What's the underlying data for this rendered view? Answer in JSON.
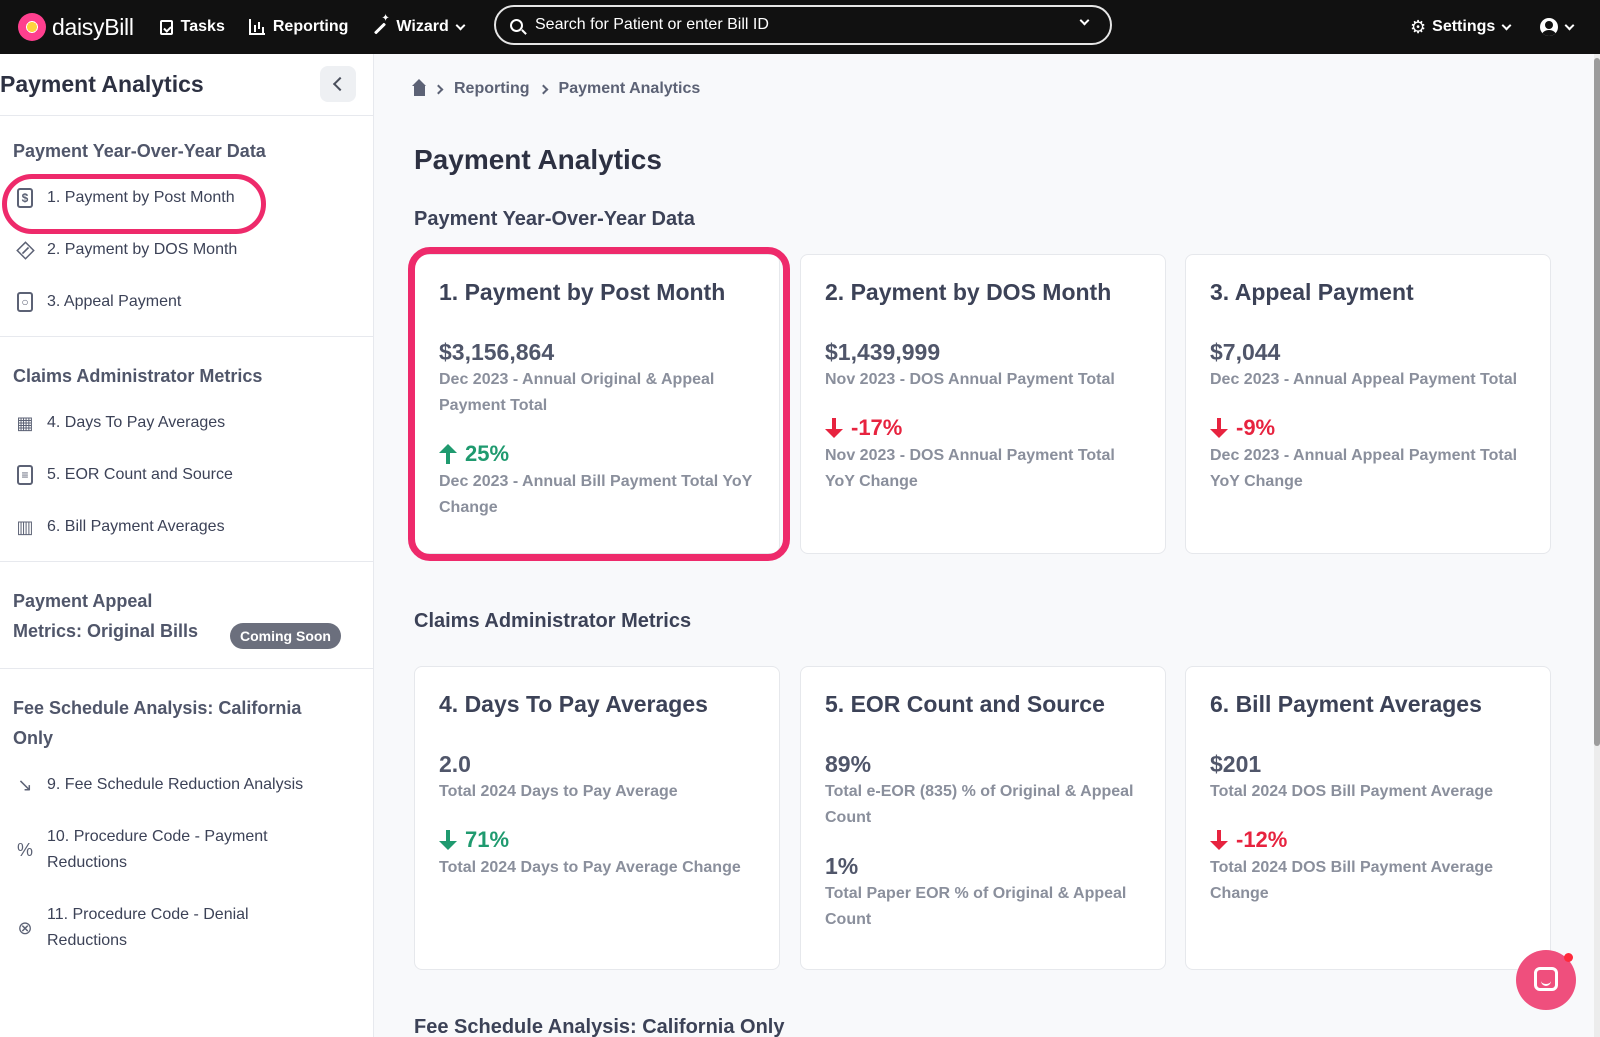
{
  "app": {
    "brand": "daisyBill"
  },
  "nav": {
    "tasks": "Tasks",
    "reporting": "Reporting",
    "wizard": "Wizard",
    "settings": "Settings"
  },
  "search": {
    "placeholder": "Search for Patient or enter Bill ID"
  },
  "sidebar": {
    "title": "Payment Analytics",
    "sections": [
      {
        "title": "Payment Year-Over-Year Data",
        "items": [
          {
            "label": "1. Payment by Post Month",
            "icon": "dollar-doc-icon"
          },
          {
            "label": "2. Payment by DOS Month",
            "icon": "bandage-icon"
          },
          {
            "label": "3. Appeal Payment",
            "icon": "appeal-doc-icon"
          }
        ]
      },
      {
        "title": "Claims Administrator Metrics",
        "items": [
          {
            "label": "4. Days To Pay Averages",
            "icon": "calendar-icon"
          },
          {
            "label": "5. EOR Count and Source",
            "icon": "document-icon"
          },
          {
            "label": "6. Bill Payment Averages",
            "icon": "bar-chart-icon"
          }
        ]
      },
      {
        "title_line1": "Payment Appeal",
        "title_line2": "Metrics: Original Bills",
        "badge": "Coming Soon"
      },
      {
        "title_line1": "Fee Schedule Analysis: California",
        "title_line2": "Only",
        "items": [
          {
            "label": "9. Fee Schedule Reduction Analysis",
            "icon": "trend-down-icon"
          },
          {
            "label_line1": "10. Procedure Code - Payment",
            "label_line2": "Reductions",
            "icon": "percent-icon"
          },
          {
            "label_line1": "11. Procedure Code - Denial",
            "label_line2": "Reductions",
            "icon": "x-circle-icon"
          }
        ]
      }
    ]
  },
  "breadcrumb": [
    "Reporting",
    "Payment Analytics"
  ],
  "main": {
    "title": "Payment Analytics",
    "section1": "Payment Year-Over-Year Data",
    "section2": "Claims Administrator Metrics",
    "section3": "Fee Schedule Analysis: California Only",
    "cards": [
      {
        "title": "1. Payment by Post Month",
        "value": "$3,156,864",
        "value_desc": "Dec 2023 - Annual Original & Appeal Payment Total",
        "change": "25%",
        "direction": "up",
        "change_desc": "Dec 2023 - Annual Bill Payment Total YoY Change"
      },
      {
        "title": "2. Payment by DOS Month",
        "value": "$1,439,999",
        "value_desc": "Nov 2023 - DOS Annual Payment Total",
        "change": "-17%",
        "direction": "down",
        "change_desc": "Nov 2023 - DOS Annual Payment Total YoY Change"
      },
      {
        "title": "3. Appeal Payment",
        "value": "$7,044",
        "value_desc": "Dec 2023 - Annual Appeal Payment Total",
        "change": "-9%",
        "direction": "down",
        "change_desc": "Dec 2023 - Annual Appeal Payment Total YoY Change"
      },
      {
        "title": "4. Days To Pay Averages",
        "value": "2.0",
        "value_desc": "Total 2024 Days to Pay Average",
        "change": "71%",
        "direction": "down-good",
        "change_desc": "Total 2024 Days to Pay Average Change"
      },
      {
        "title": "5. EOR Count and Source",
        "value": "89%",
        "value_desc": "Total e-EOR (835) % of Original & Appeal Count",
        "value2": "1%",
        "value2_desc": "Total Paper EOR % of Original & Appeal Count"
      },
      {
        "title": "6. Bill Payment Averages",
        "value": "$201",
        "value_desc": "Total 2024 DOS Bill Payment Average",
        "change": "-12%",
        "direction": "down",
        "change_desc": "Total 2024 DOS Bill Payment Average Change"
      }
    ]
  },
  "colors": {
    "accent_pink": "#ee2a6b",
    "positive_green": "#1f9a6f",
    "negative_red": "#e7233f",
    "topbar": "#111111"
  }
}
